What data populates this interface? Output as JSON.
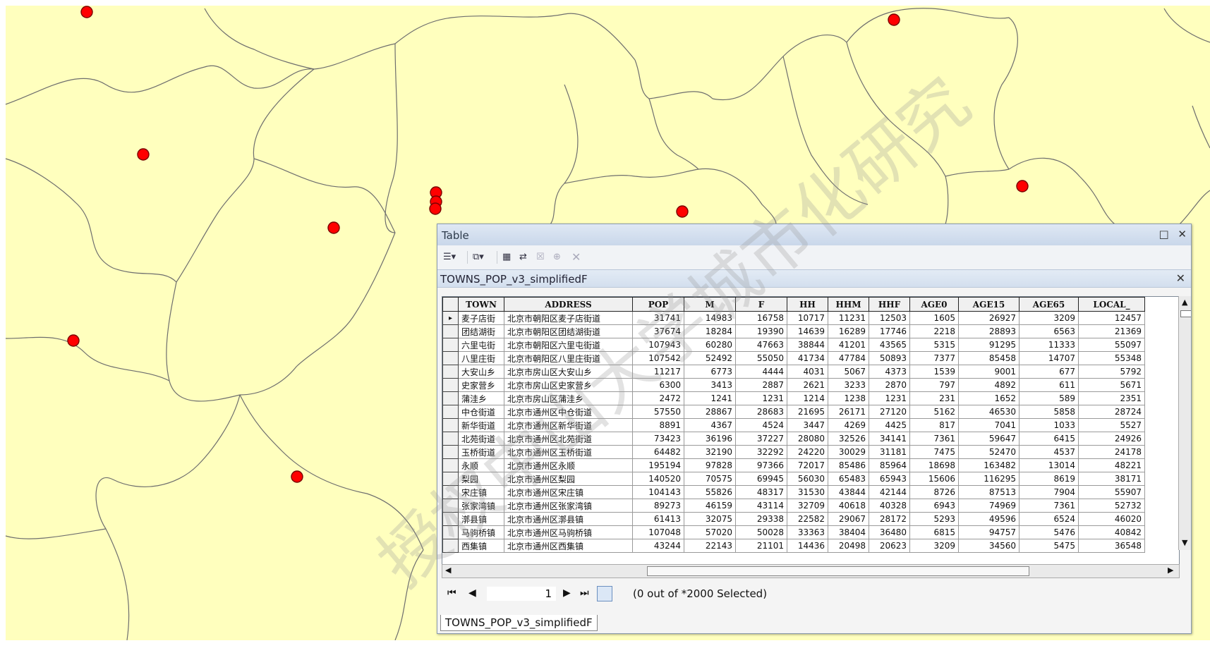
{
  "colors": {
    "map_fill": "#ffffbe",
    "boundary": "#6e6e6e",
    "point_fill": "#ff0000",
    "watermark": "#969696"
  },
  "watermark_text": "授权中山大学城市化研究",
  "window": {
    "title": "Table",
    "maximize_icon": "maximize-icon",
    "close_icon": "close-icon",
    "toolbar_icons": [
      "table-options-icon",
      "related-tables-icon",
      "select-by-attributes-icon",
      "switch-selection-icon",
      "clear-selection-icon",
      "zoom-to-selected-icon",
      "delete-selected-icon"
    ],
    "layer_tab_title": "TOWNS_POP_v3_simplifiedF",
    "columns": [
      "TOWN",
      "ADDRESS",
      "POP",
      "M",
      "F",
      "HH",
      "HHM",
      "HHF",
      "AGE0",
      "AGE15",
      "AGE65",
      "LOCAL_"
    ],
    "rows": [
      [
        "麦子店街",
        "北京市朝阳区麦子店街道",
        "31741",
        "14983",
        "16758",
        "10717",
        "11231",
        "12503",
        "1605",
        "26927",
        "3209",
        "12457"
      ],
      [
        "团结湖街",
        "北京市朝阳区团结湖街道",
        "37674",
        "18284",
        "19390",
        "14639",
        "16289",
        "17746",
        "2218",
        "28893",
        "6563",
        "21369"
      ],
      [
        "六里屯街",
        "北京市朝阳区六里屯街道",
        "107943",
        "60280",
        "47663",
        "38844",
        "41201",
        "43565",
        "5315",
        "91295",
        "11333",
        "55097"
      ],
      [
        "八里庄街",
        "北京市朝阳区八里庄街道",
        "107542",
        "52492",
        "55050",
        "41734",
        "47784",
        "50893",
        "7377",
        "85458",
        "14707",
        "55348"
      ],
      [
        "大安山乡",
        "北京市房山区大安山乡",
        "11217",
        "6773",
        "4444",
        "4031",
        "5067",
        "4373",
        "1539",
        "9001",
        "677",
        "5792"
      ],
      [
        "史家营乡",
        "北京市房山区史家营乡",
        "6300",
        "3413",
        "2887",
        "2621",
        "3233",
        "2870",
        "797",
        "4892",
        "611",
        "5671"
      ],
      [
        "蒲洼乡",
        "北京市房山区蒲洼乡",
        "2472",
        "1241",
        "1231",
        "1214",
        "1238",
        "1231",
        "231",
        "1652",
        "589",
        "2351"
      ],
      [
        "中仓街道",
        "北京市通州区中仓街道",
        "57550",
        "28867",
        "28683",
        "21695",
        "26171",
        "27120",
        "5162",
        "46530",
        "5858",
        "28724"
      ],
      [
        "新华街道",
        "北京市通州区新华街道",
        "8891",
        "4367",
        "4524",
        "3447",
        "4269",
        "4425",
        "817",
        "7041",
        "1033",
        "5527"
      ],
      [
        "北苑街道",
        "北京市通州区北苑街道",
        "73423",
        "36196",
        "37227",
        "28080",
        "32526",
        "34141",
        "7361",
        "59647",
        "6415",
        "24926"
      ],
      [
        "玉桥街道",
        "北京市通州区玉桥街道",
        "64482",
        "32190",
        "32292",
        "24220",
        "30029",
        "31181",
        "7475",
        "52470",
        "4537",
        "24178"
      ],
      [
        "永顺",
        "北京市通州区永顺",
        "195194",
        "97828",
        "97366",
        "72017",
        "85486",
        "85964",
        "18698",
        "163482",
        "13014",
        "48221"
      ],
      [
        "梨园",
        "北京市通州区梨园",
        "140520",
        "70575",
        "69945",
        "56030",
        "65483",
        "65943",
        "15606",
        "116295",
        "8619",
        "38171"
      ],
      [
        "宋庄镇",
        "北京市通州区宋庄镇",
        "104143",
        "55826",
        "48317",
        "31530",
        "43844",
        "42144",
        "8726",
        "87513",
        "7904",
        "55907"
      ],
      [
        "张家湾镇",
        "北京市通州区张家湾镇",
        "89273",
        "46159",
        "43114",
        "32709",
        "40618",
        "40328",
        "6943",
        "74969",
        "7361",
        "52732"
      ],
      [
        "漷县镇",
        "北京市通州区漷县镇",
        "61413",
        "32075",
        "29338",
        "22582",
        "29067",
        "28172",
        "5293",
        "49596",
        "6524",
        "46020"
      ],
      [
        "马驹桥镇",
        "北京市通州区马驹桥镇",
        "107048",
        "57020",
        "50028",
        "33363",
        "38404",
        "36480",
        "6815",
        "94757",
        "5476",
        "40842"
      ],
      [
        "西集镇",
        "北京市通州区西集镇",
        "43244",
        "22143",
        "21101",
        "14436",
        "20498",
        "20623",
        "3209",
        "34560",
        "5475",
        "36548"
      ]
    ],
    "current_row_marker": "▸",
    "record_number": "1",
    "selection_status": "(0 out of *2000 Selected)",
    "bottom_tab": "TOWNS_POP_v3_simplifiedF"
  }
}
